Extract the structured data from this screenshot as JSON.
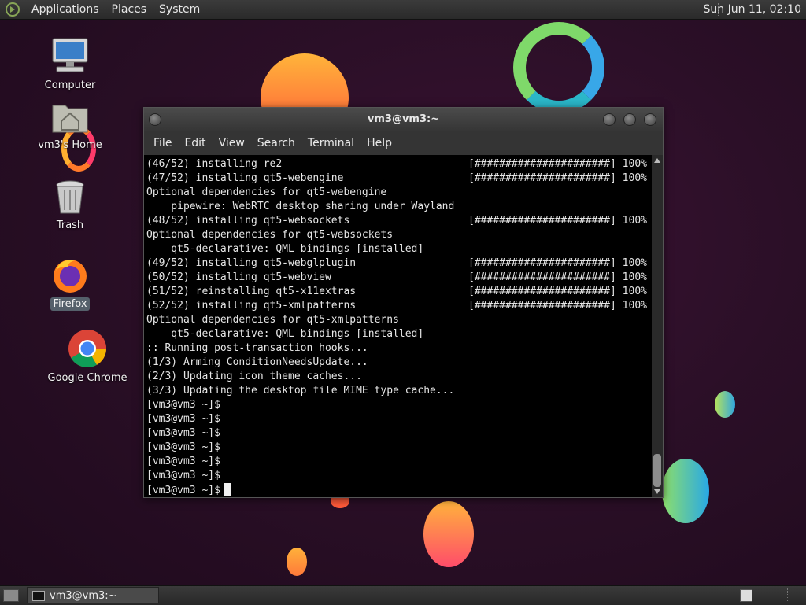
{
  "top_panel": {
    "menus": [
      "Applications",
      "Places",
      "System"
    ],
    "clock": "Sun Jun 11, 02:10"
  },
  "desktop_icons": [
    {
      "label": "Computer",
      "icon": "computer-icon"
    },
    {
      "label": "vm3's Home",
      "icon": "home-folder-icon"
    },
    {
      "label": "Trash",
      "icon": "trash-icon"
    },
    {
      "label": "Firefox",
      "icon": "firefox-icon",
      "selected": true
    },
    {
      "label": "Google Chrome",
      "icon": "chrome-icon"
    }
  ],
  "window": {
    "title": "vm3@vm3:~",
    "menus": [
      "File",
      "Edit",
      "View",
      "Search",
      "Terminal",
      "Help"
    ]
  },
  "terminal": {
    "lines": [
      {
        "text": "(46/52) installing re2",
        "bar": "[######################] 100%"
      },
      {
        "text": "(47/52) installing qt5-webengine",
        "bar": "[######################] 100%"
      },
      {
        "text": "Optional dependencies for qt5-webengine"
      },
      {
        "text": "    pipewire: WebRTC desktop sharing under Wayland"
      },
      {
        "text": "(48/52) installing qt5-websockets",
        "bar": "[######################] 100%"
      },
      {
        "text": "Optional dependencies for qt5-websockets"
      },
      {
        "text": "    qt5-declarative: QML bindings [installed]"
      },
      {
        "text": "(49/52) installing qt5-webglplugin",
        "bar": "[######################] 100%"
      },
      {
        "text": "(50/52) installing qt5-webview",
        "bar": "[######################] 100%"
      },
      {
        "text": "(51/52) reinstalling qt5-x11extras",
        "bar": "[######################] 100%"
      },
      {
        "text": "(52/52) installing qt5-xmlpatterns",
        "bar": "[######################] 100%"
      },
      {
        "text": "Optional dependencies for qt5-xmlpatterns"
      },
      {
        "text": "    qt5-declarative: QML bindings [installed]"
      },
      {
        "text": ":: Running post-transaction hooks..."
      },
      {
        "text": "(1/3) Arming ConditionNeedsUpdate..."
      },
      {
        "text": "(2/3) Updating icon theme caches..."
      },
      {
        "text": "(3/3) Updating the desktop file MIME type cache..."
      },
      {
        "text": "[vm3@vm3 ~]$"
      },
      {
        "text": "[vm3@vm3 ~]$"
      },
      {
        "text": "[vm3@vm3 ~]$"
      },
      {
        "text": "[vm3@vm3 ~]$"
      },
      {
        "text": "[vm3@vm3 ~]$"
      },
      {
        "text": "[vm3@vm3 ~]$"
      }
    ],
    "prompt": "[vm3@vm3 ~]$"
  },
  "taskbar": {
    "task_label": "vm3@vm3:~"
  }
}
